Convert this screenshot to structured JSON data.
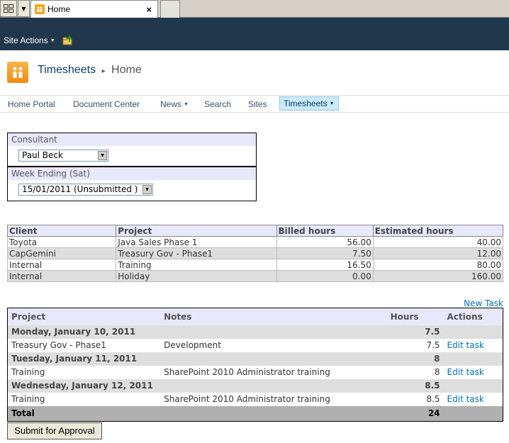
{
  "browser": {
    "tab_title": "Home",
    "tab_close": "×"
  },
  "ribbon": {
    "site_actions_label": "Site Actions",
    "bg_color": "#21374c"
  },
  "breadcrumb": {
    "site": "Timesheets",
    "separator": "▸",
    "page": "Home"
  },
  "topnav": {
    "items": [
      {
        "label": "Home Portal"
      },
      {
        "label": "Document Center"
      },
      {
        "label": "News"
      },
      {
        "label": "Search"
      },
      {
        "label": "Sites"
      },
      {
        "label": "Timesheets"
      }
    ]
  },
  "consultant": {
    "label": "Consultant",
    "selected": "Paul Beck"
  },
  "week": {
    "label": "Week Ending (Sat)",
    "selected": "15/01/2011 (Unsubmitted )"
  },
  "summary": {
    "headers": [
      "Client",
      "Project",
      "Billed hours",
      "Estimated hours"
    ],
    "rows": [
      [
        "Toyota",
        "Java Sales Phase 1",
        "56.00",
        "40.00"
      ],
      [
        "CapGemini",
        "Treasury Gov - Phase1",
        "7.50",
        "12.00"
      ],
      [
        "Internal",
        "Training",
        "16.50",
        "80.00"
      ],
      [
        "Internal",
        "Holiday",
        "0.00",
        "160.00"
      ]
    ]
  },
  "tasks": {
    "new_task_label": "New Task",
    "headers": [
      "Project",
      "Notes",
      "Hours",
      "Actions"
    ],
    "days": [
      {
        "date": "Monday, January 10, 2011",
        "total": "7.5",
        "entry": {
          "project": "Treasury Gov - Phase1",
          "notes": "Development",
          "hours": "7.5",
          "action": "Edit task"
        }
      },
      {
        "date": "Tuesday, January 11, 2011",
        "total": "8",
        "entry": {
          "project": "Training",
          "notes": "SharePoint 2010 Administrator training",
          "hours": "8",
          "action": "Edit task"
        }
      },
      {
        "date": "Wednesday, January 12, 2011",
        "total": "8.5",
        "entry": {
          "project": "Training",
          "notes": "SharePoint 2010 Administrator training",
          "hours": "8.5",
          "action": "Edit task"
        }
      }
    ],
    "total_label": "Total",
    "total_hours": "24"
  },
  "submit_label": "Submit for Approval"
}
